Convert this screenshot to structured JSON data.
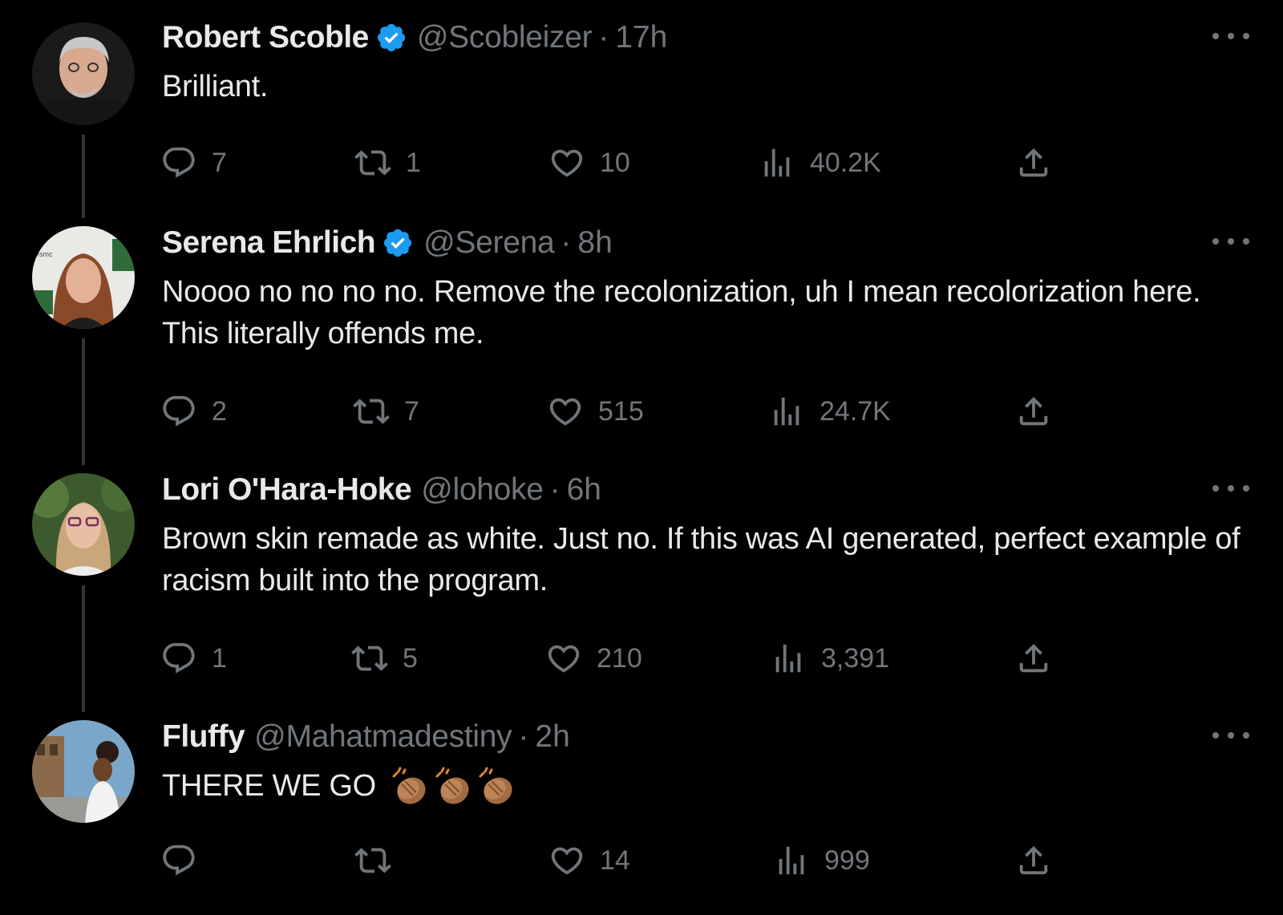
{
  "tweets": [
    {
      "name": "Robert Scoble",
      "verified": true,
      "handle": "@Scobleizer",
      "separator": "·",
      "time": "17h",
      "text": "Brilliant.",
      "replies": "7",
      "retweets": "1",
      "likes": "10",
      "views": "40.2K"
    },
    {
      "name": "Serena Ehrlich",
      "verified": true,
      "handle": "@Serena",
      "separator": "·",
      "time": "8h",
      "text": "Noooo no no no no. Remove the recolonization, uh I mean recolorization here. This literally offends me.",
      "replies": "2",
      "retweets": "7",
      "likes": "515",
      "views": "24.7K"
    },
    {
      "name": "Lori O'Hara-Hoke",
      "verified": false,
      "handle": "@lohoke",
      "separator": "·",
      "time": "6h",
      "text": "Brown skin remade as white. Just no. If this was AI generated, perfect example of racism built into the program.",
      "replies": "1",
      "retweets": "5",
      "likes": "210",
      "views": "3,391"
    },
    {
      "name": "Fluffy",
      "verified": false,
      "handle": "@Mahatmadestiny",
      "separator": "·",
      "time": "2h",
      "text": "THERE WE GO",
      "emoji": "clapping-hands-medium-skin-x3",
      "replies": "",
      "retweets": "",
      "likes": "14",
      "views": "999"
    }
  ],
  "colors": {
    "background": "#000000",
    "text": "#e7e9ea",
    "muted": "#71767b",
    "verified_badge": "#1d9bf0",
    "thread_line": "#333639"
  },
  "icons": [
    "reply-icon",
    "retweet-icon",
    "like-icon",
    "views-icon",
    "share-icon",
    "more-icon",
    "verified-badge-icon"
  ]
}
